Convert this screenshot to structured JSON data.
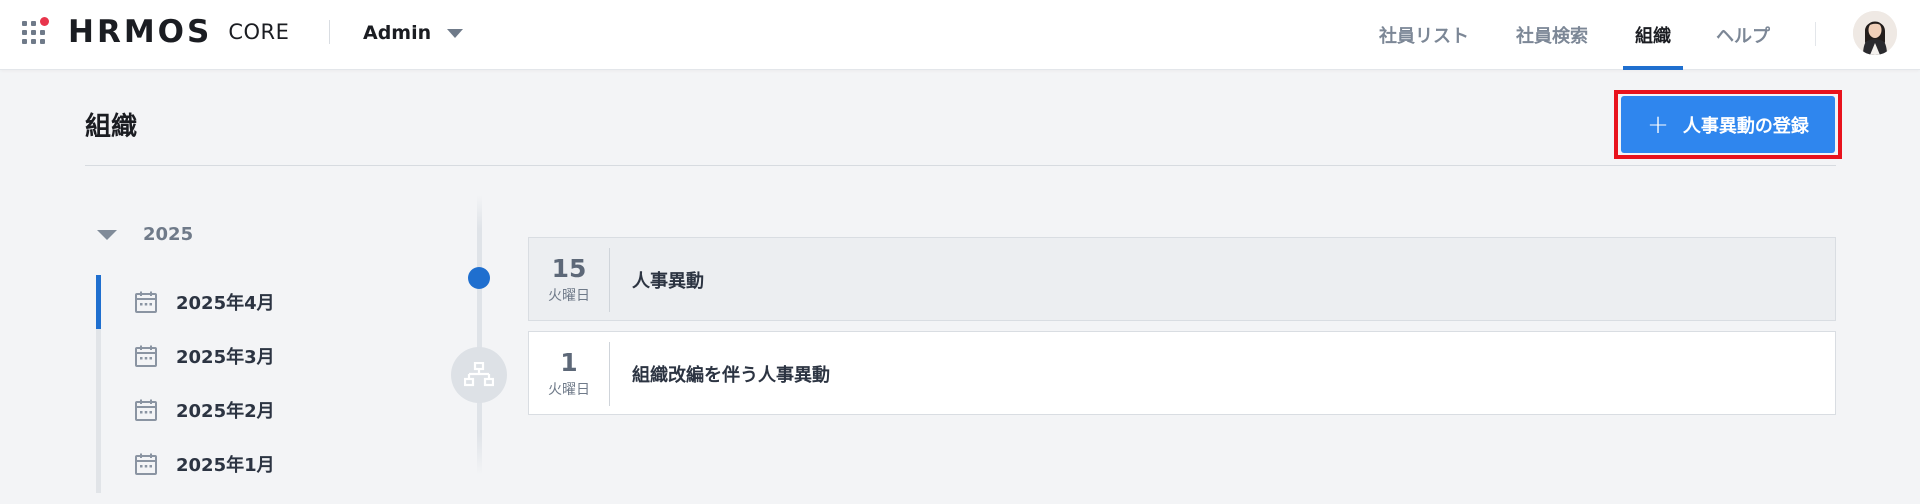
{
  "header": {
    "logo_main": "HRMOS",
    "logo_sub": "CORE",
    "role": "Admin",
    "nav": [
      {
        "label": "社員リスト",
        "active": false
      },
      {
        "label": "社員検索",
        "active": false
      },
      {
        "label": "組織",
        "active": true
      },
      {
        "label": "ヘルプ",
        "active": false
      }
    ]
  },
  "page": {
    "title": "組織",
    "add_button_label": "人事異動の登録",
    "add_button_icon": "plus-icon"
  },
  "tree": {
    "year": "2025",
    "months": [
      "2025年4月",
      "2025年3月",
      "2025年2月",
      "2025年1月"
    ],
    "active_month_index": 0
  },
  "events": [
    {
      "day": "15",
      "weekday": "火曜日",
      "title": "人事異動",
      "marker": "dot"
    },
    {
      "day": "1",
      "weekday": "火曜日",
      "title": "組織改編を伴う人事異動",
      "marker": "org-chart-icon"
    }
  ],
  "colors": {
    "accent": "#1f6fcf",
    "button": "#2f86ee",
    "highlight_frame": "#e8121d",
    "app_dot": "#e8354c"
  }
}
